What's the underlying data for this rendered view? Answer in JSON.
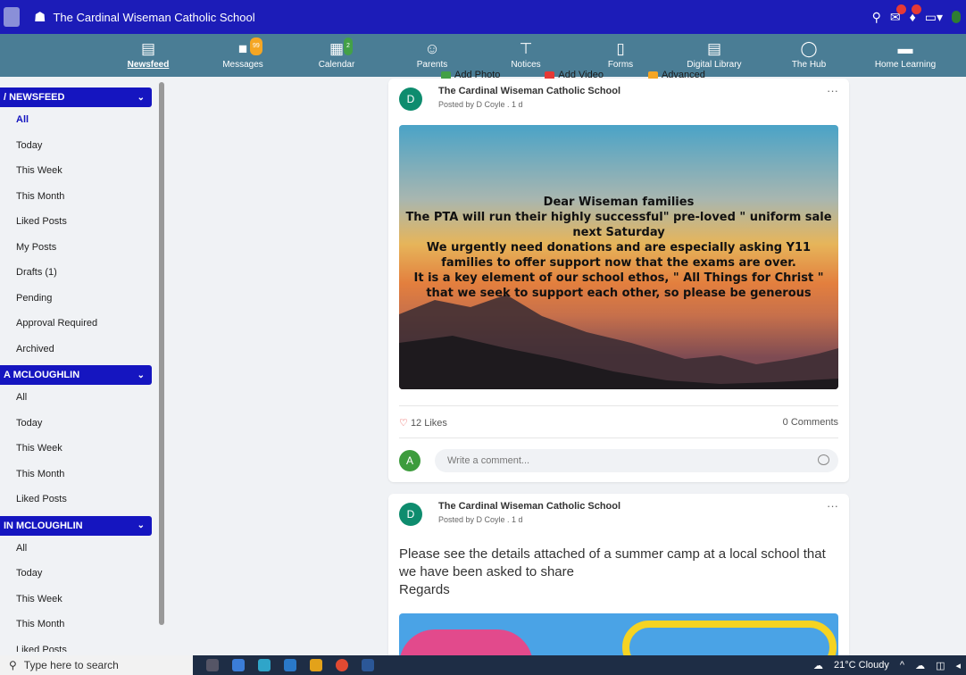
{
  "header": {
    "school_title": "The Cardinal Wiseman Catholic School",
    "badges": {
      "messages": "",
      "notifications": ""
    }
  },
  "nav": {
    "items": [
      {
        "label": "Newsfeed",
        "icon": "newspaper-icon",
        "badge": ""
      },
      {
        "label": "Messages",
        "icon": "chat-icon",
        "badge": "99"
      },
      {
        "label": "Calendar",
        "icon": "calendar-icon",
        "badge": "2"
      },
      {
        "label": "Parents",
        "icon": "parents-icon",
        "badge": ""
      },
      {
        "label": "Notices",
        "icon": "signpost-icon",
        "badge": ""
      },
      {
        "label": "Forms",
        "icon": "form-icon",
        "badge": ""
      },
      {
        "label": "Digital Library",
        "icon": "book-icon",
        "badge": ""
      },
      {
        "label": "The Hub",
        "icon": "hub-icon",
        "badge": ""
      },
      {
        "label": "Home Learning",
        "icon": "briefcase-icon",
        "badge": ""
      }
    ],
    "overlay_tools": [
      "Add Photo",
      "Add Video",
      "Advanced"
    ]
  },
  "sidebar": {
    "sections": [
      {
        "title": "/ NEWSFEED",
        "items": [
          "All",
          "Today",
          "This Week",
          "This Month",
          "Liked Posts",
          "My Posts",
          "Drafts (1)",
          "Pending",
          "Approval Required",
          "Archived"
        ]
      },
      {
        "title": "A MCLOUGHLIN",
        "items": [
          "All",
          "Today",
          "This Week",
          "This Month",
          "Liked Posts"
        ]
      },
      {
        "title": "IN MCLOUGHLIN",
        "items": [
          "All",
          "Today",
          "This Week",
          "This Month",
          "Liked Posts"
        ]
      }
    ]
  },
  "posts": [
    {
      "avatar": "D",
      "author": "The Cardinal Wiseman Catholic School",
      "posted_by": "Posted by D Coyle . 1 d",
      "banner_lines": [
        "Dear Wiseman families",
        "The PTA will run their highly successful\" pre-loved \" uniform sale",
        "next Saturday",
        "We urgently need donations and are especially asking Y11",
        "families to offer support now that the exams are over.",
        "It is a key element of our school ethos, \" All Things for Christ \"",
        "that we seek to support each other, so please be generous"
      ],
      "likes": "12 Likes",
      "comments": "0 Comments",
      "comment_avatar": "A",
      "comment_placeholder": "Write a comment..."
    },
    {
      "avatar": "D",
      "author": "The Cardinal Wiseman Catholic School",
      "posted_by": "Posted by D Coyle . 1 d",
      "body": "Please see the details attached  of a summer camp at a local school that we have been asked to share\nRegards"
    }
  ],
  "taskbar": {
    "search_placeholder": "Type here to search",
    "weather": "21°C  Cloudy"
  },
  "colors": {
    "topbar": "#1c1cb8",
    "navbar": "#4a7d95",
    "sidebar_header": "#1515c0",
    "avatar_green": "#0e8c6e"
  }
}
